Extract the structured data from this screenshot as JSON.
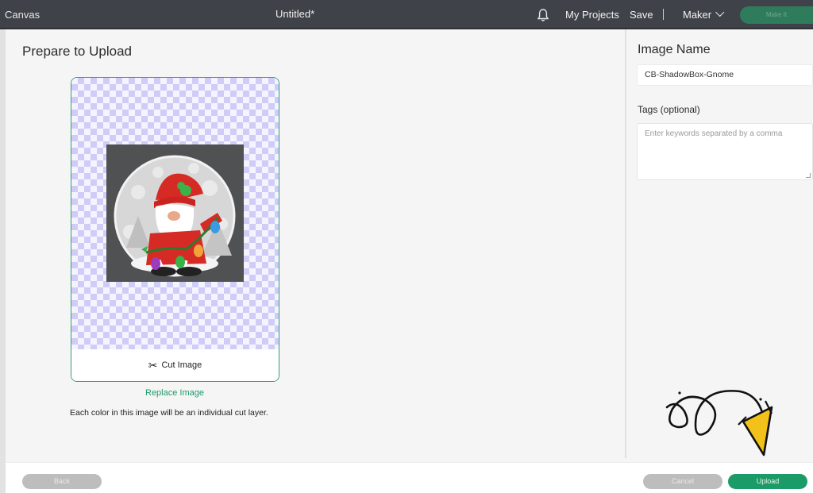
{
  "topbar": {
    "app_name": "Canvas",
    "doc_title": "Untitled*",
    "notifications_icon": "bell-icon",
    "my_projects": "My Projects",
    "save": "Save",
    "separator": "|",
    "machine": "Maker",
    "make_it": "Make It"
  },
  "main": {
    "title": "Prepare to Upload",
    "cut_image_icon": "scissors-icon",
    "cut_image_label": "Cut Image",
    "replace_image": "Replace Image",
    "info": "Each color in this image will be an individual cut layer."
  },
  "sidebar": {
    "image_name_label": "Image Name",
    "image_name_value": "CB-ShadowBox-Gnome",
    "tags_label": "Tags (optional)",
    "tags_placeholder": "Enter keywords separated by a comma"
  },
  "footer": {
    "back": "Back",
    "cancel": "Cancel",
    "upload": "Upload"
  },
  "colors": {
    "topbar_bg": "#3f4248",
    "accent_green": "#1a9b68",
    "card_border": "#3a9d7c",
    "checker": "#cfcdf7",
    "disabled_button": "#bdbdbd",
    "doodle_yellow": "#f2c21b"
  }
}
